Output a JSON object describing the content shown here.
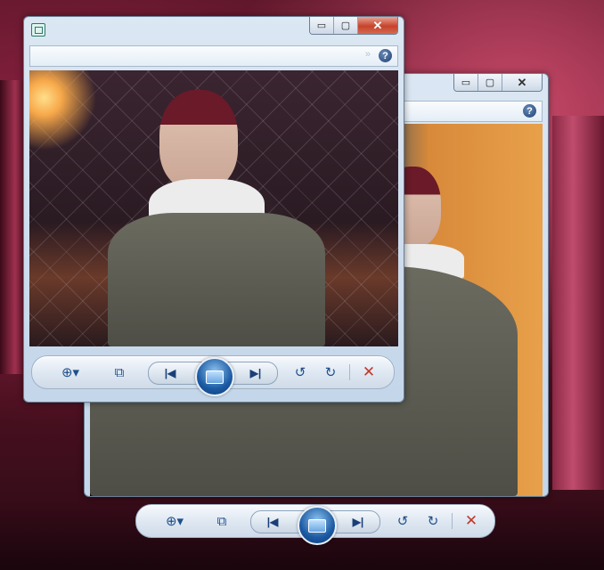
{
  "desktop": {
    "background_accent": "#7a1f3a"
  },
  "windows": [
    {
      "id": "back",
      "caption": {
        "minimize": "▭",
        "maximize": "▢",
        "close": "✕"
      },
      "help_label": "?",
      "toolbar": {
        "zoom": "⊕▾",
        "fit": "⧉",
        "prev": "|◀",
        "next": "▶|",
        "rotate_ccw": "↺",
        "rotate_cw": "↻",
        "delete": "✕"
      }
    },
    {
      "id": "front",
      "caption": {
        "minimize": "▭",
        "maximize": "▢",
        "close": "✕"
      },
      "help_label": "?",
      "hint": "»",
      "toolbar": {
        "zoom": "⊕▾",
        "fit": "⧉",
        "prev": "|◀",
        "next": "▶|",
        "rotate_ccw": "↺",
        "rotate_cw": "↻",
        "delete": "✕"
      }
    }
  ],
  "icons": {
    "app": "photo-viewer-icon",
    "slideshow": "slideshow-icon",
    "help": "help-icon"
  }
}
